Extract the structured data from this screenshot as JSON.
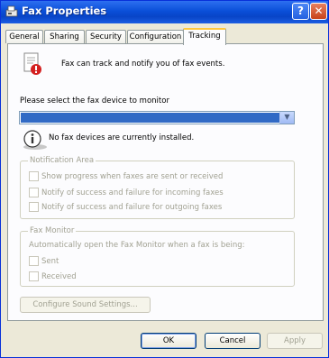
{
  "window": {
    "title": "Fax Properties"
  },
  "titlebar": {
    "help_label": "?",
    "close_label": "✕"
  },
  "tabs": [
    {
      "label": "General"
    },
    {
      "label": "Sharing"
    },
    {
      "label": "Security"
    },
    {
      "label": "Configuration"
    },
    {
      "label": "Tracking"
    }
  ],
  "tracking": {
    "description": "Fax can track and notify you of fax events.",
    "select_label": "Please select the fax device to monitor",
    "device_value": "",
    "info_text": "No fax devices are currently installed.",
    "notification_area": {
      "title": "Notification Area",
      "options": [
        {
          "label": "Show progress when faxes are sent or received"
        },
        {
          "label": "Notify of success and failure for incoming faxes"
        },
        {
          "label": "Notify of success and failure for outgoing faxes"
        }
      ]
    },
    "fax_monitor": {
      "title": "Fax Monitor",
      "description": "Automatically open the Fax Monitor when a fax is being:",
      "options": [
        {
          "label": "Sent"
        },
        {
          "label": "Received"
        }
      ]
    },
    "sound_button": "Configure Sound Settings..."
  },
  "footer": {
    "ok": "OK",
    "cancel": "Cancel",
    "apply": "Apply"
  }
}
